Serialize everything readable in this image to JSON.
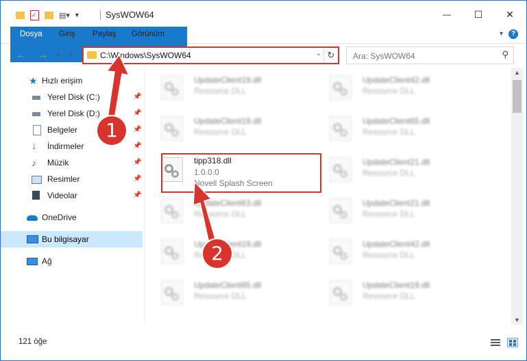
{
  "window": {
    "title": "SysWOW64",
    "controls": {
      "minimize": "—",
      "maximize": "☐",
      "close": "✕"
    }
  },
  "ribbon": {
    "tabs": [
      "Dosya",
      "Giriş",
      "Paylaş",
      "Görünüm"
    ],
    "help": "?"
  },
  "address": {
    "path": "C:\\Windows\\SysWOW64",
    "search_placeholder": "Ara: SysWOW64"
  },
  "nav": {
    "items": [
      {
        "label": "Hızlı erişim",
        "icon": "star-icon",
        "pinned": false
      },
      {
        "label": "Yerel Disk (C:)",
        "icon": "drive-icon",
        "pinned": true
      },
      {
        "label": "Yerel Disk (D:)",
        "icon": "drive-icon",
        "pinned": true
      },
      {
        "label": "Belgeler",
        "icon": "documents-icon",
        "pinned": true
      },
      {
        "label": "İndirmeler",
        "icon": "download-icon",
        "pinned": true
      },
      {
        "label": "Müzik",
        "icon": "music-icon",
        "pinned": true
      },
      {
        "label": "Resimler",
        "icon": "pictures-icon",
        "pinned": true
      },
      {
        "label": "Videolar",
        "icon": "videos-icon",
        "pinned": true
      },
      {
        "label": "OneDrive",
        "icon": "cloud-icon",
        "pinned": false
      },
      {
        "label": "Bu bilgisayar",
        "icon": "computer-icon",
        "pinned": false,
        "selected": true
      },
      {
        "label": "Ağ",
        "icon": "network-icon",
        "pinned": false
      }
    ]
  },
  "files": [
    {
      "name": "UpdateClient19.dll",
      "line2": "Resource DLL",
      "line3": "",
      "blurred": true
    },
    {
      "name": "UpdateClient42.dll",
      "line2": "Resource DLL",
      "line3": "",
      "blurred": true
    },
    {
      "name": "UpdateClient19.dll",
      "line2": "Resource DLL",
      "line3": "",
      "blurred": true
    },
    {
      "name": "UpdateClient65.dll",
      "line2": "Resource DLL",
      "line3": "",
      "blurred": true
    },
    {
      "name": "tipp318.dll",
      "line2": "1.0.0.0",
      "line3": "Novell Splash Screen",
      "blurred": false
    },
    {
      "name": "UpdateClient21.dll",
      "line2": "Resource DLL",
      "line3": "",
      "blurred": true
    },
    {
      "name": "UpdateClient63.dll",
      "line2": "Resource DLL",
      "line3": "",
      "blurred": true
    },
    {
      "name": "UpdateClient21.dll",
      "line2": "Resource DLL",
      "line3": "",
      "blurred": true
    },
    {
      "name": "UpdateClient19.dll",
      "line2": "Resource DLL",
      "line3": "",
      "blurred": true
    },
    {
      "name": "UpdateClient42.dll",
      "line2": "Resource DLL",
      "line3": "",
      "blurred": true
    },
    {
      "name": "UpdateClient65.dll",
      "line2": "Resource DLL",
      "line3": "",
      "blurred": true
    },
    {
      "name": "UpdateClient19.dll",
      "line2": "Resource DLL",
      "line3": "",
      "blurred": true
    }
  ],
  "status": {
    "count": "121 öğe"
  },
  "annotations": {
    "step1": "1",
    "step2": "2",
    "color": "#d9342b"
  }
}
